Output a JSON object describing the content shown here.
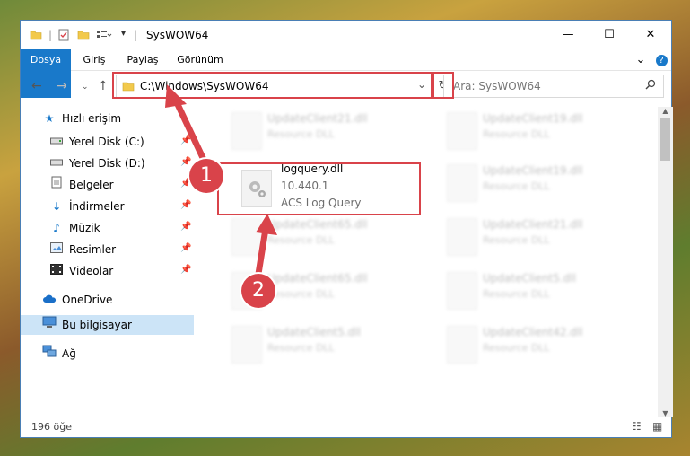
{
  "window": {
    "title": "SysWOW64",
    "minimize": "—",
    "maximize": "☐",
    "close": "✕"
  },
  "ribbon": {
    "tabs": [
      "Dosya",
      "Giriş",
      "Paylaş",
      "Görünüm"
    ],
    "collapse": "⌄",
    "help": "?"
  },
  "nav": {
    "address": "C:\\Windows\\SysWOW64",
    "search_placeholder": "Ara: SysWOW64"
  },
  "sidebar": {
    "quick_access": "Hızlı erişim",
    "items": [
      {
        "label": "Yerel Disk (C:)",
        "icon": "drive-icon"
      },
      {
        "label": "Yerel Disk (D:)",
        "icon": "drive-icon"
      },
      {
        "label": "Belgeler",
        "icon": "documents-icon"
      },
      {
        "label": "İndirmeler",
        "icon": "downloads-icon"
      },
      {
        "label": "Müzik",
        "icon": "music-icon"
      },
      {
        "label": "Resimler",
        "icon": "pictures-icon"
      },
      {
        "label": "Videolar",
        "icon": "videos-icon"
      }
    ],
    "onedrive": "OneDrive",
    "this_pc": "Bu bilgisayar",
    "network": "Ağ"
  },
  "files": {
    "highlighted": {
      "name": "logquery.dll",
      "version": "10.440.1",
      "description": "ACS Log Query"
    },
    "blurred": [
      {
        "name": "UpdateClient21.dll",
        "type": "Resource DLL"
      },
      {
        "name": "UpdateClient19.dll",
        "type": "Resource DLL"
      },
      {
        "name": "UpdateClient19.dll",
        "type": "Resource DLL"
      },
      {
        "name": "UpdateClient65.dll",
        "type": "Resource DLL"
      },
      {
        "name": "UpdateClient21.dll",
        "type": "Resource DLL"
      },
      {
        "name": "UpdateClient65.dll",
        "type": "Resource DLL"
      },
      {
        "name": "UpdateClient5.dll",
        "type": "Resource DLL"
      },
      {
        "name": "UpdateClient5.dll",
        "type": "Resource DLL"
      },
      {
        "name": "UpdateClient42.dll",
        "type": "Resource DLL"
      }
    ]
  },
  "status": {
    "count": "196 öğe"
  },
  "callouts": {
    "one": "1",
    "two": "2"
  },
  "colors": {
    "accent": "#1979ca",
    "highlight_red": "#d9434a",
    "selection": "#cce4f7"
  }
}
